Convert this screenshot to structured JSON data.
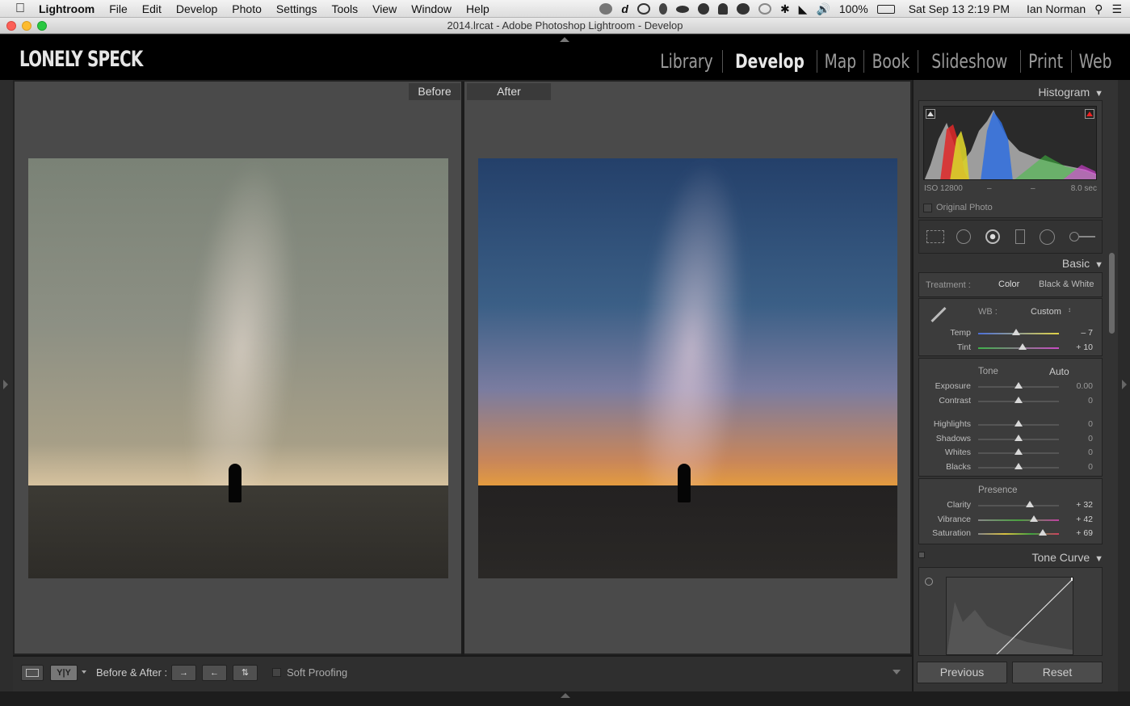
{
  "menubar": {
    "app": "Lightroom",
    "items": [
      "File",
      "Edit",
      "Develop",
      "Photo",
      "Settings",
      "Tools",
      "View",
      "Window",
      "Help"
    ],
    "battery": "100%",
    "datetime": "Sat Sep 13  2:19 PM",
    "user": "Ian Norman"
  },
  "window": {
    "title": "2014.lrcat - Adobe Photoshop Lightroom - Develop"
  },
  "identity_plate": "LONELY SPECK",
  "modules": [
    {
      "label": "Library",
      "active": false
    },
    {
      "label": "Develop",
      "active": true
    },
    {
      "label": "Map",
      "active": false
    },
    {
      "label": "Book",
      "active": false
    },
    {
      "label": "Slideshow",
      "active": false
    },
    {
      "label": "Print",
      "active": false
    },
    {
      "label": "Web",
      "active": false
    }
  ],
  "view": {
    "before_label": "Before",
    "after_label": "After"
  },
  "toolbar": {
    "before_after_label": "Before & After :",
    "soft_proofing": "Soft Proofing"
  },
  "histogram": {
    "title": "Histogram",
    "iso": "ISO 12800",
    "dash1": "–",
    "dash2": "–",
    "shutter": "8.0 sec",
    "original_photo": "Original Photo"
  },
  "basic": {
    "title": "Basic",
    "treatment_label": "Treatment :",
    "color": "Color",
    "bw": "Black & White",
    "wb_label": "WB :",
    "wb_value": "Custom",
    "tone_label": "Tone",
    "auto": "Auto",
    "presence_label": "Presence",
    "sliders": {
      "temp": {
        "label": "Temp",
        "value": "– 7",
        "pos": 0.47
      },
      "tint": {
        "label": "Tint",
        "value": "+ 10",
        "pos": 0.55
      },
      "exposure": {
        "label": "Exposure",
        "value": "0.00",
        "pos": 0.5
      },
      "contrast": {
        "label": "Contrast",
        "value": "0",
        "pos": 0.5
      },
      "highlights": {
        "label": "Highlights",
        "value": "0",
        "pos": 0.5
      },
      "shadows": {
        "label": "Shadows",
        "value": "0",
        "pos": 0.5
      },
      "whites": {
        "label": "Whites",
        "value": "0",
        "pos": 0.5
      },
      "blacks": {
        "label": "Blacks",
        "value": "0",
        "pos": 0.5
      },
      "clarity": {
        "label": "Clarity",
        "value": "+ 32",
        "pos": 0.64
      },
      "vibrance": {
        "label": "Vibrance",
        "value": "+ 42",
        "pos": 0.69
      },
      "saturation": {
        "label": "Saturation",
        "value": "+ 69",
        "pos": 0.8
      }
    }
  },
  "tone_curve": {
    "title": "Tone Curve"
  },
  "buttons": {
    "previous": "Previous",
    "reset": "Reset"
  },
  "colors": {
    "panel": "#333333",
    "section": "#3c3c3c",
    "background": "#4a4a4a",
    "accent": "#e8e8e8"
  }
}
